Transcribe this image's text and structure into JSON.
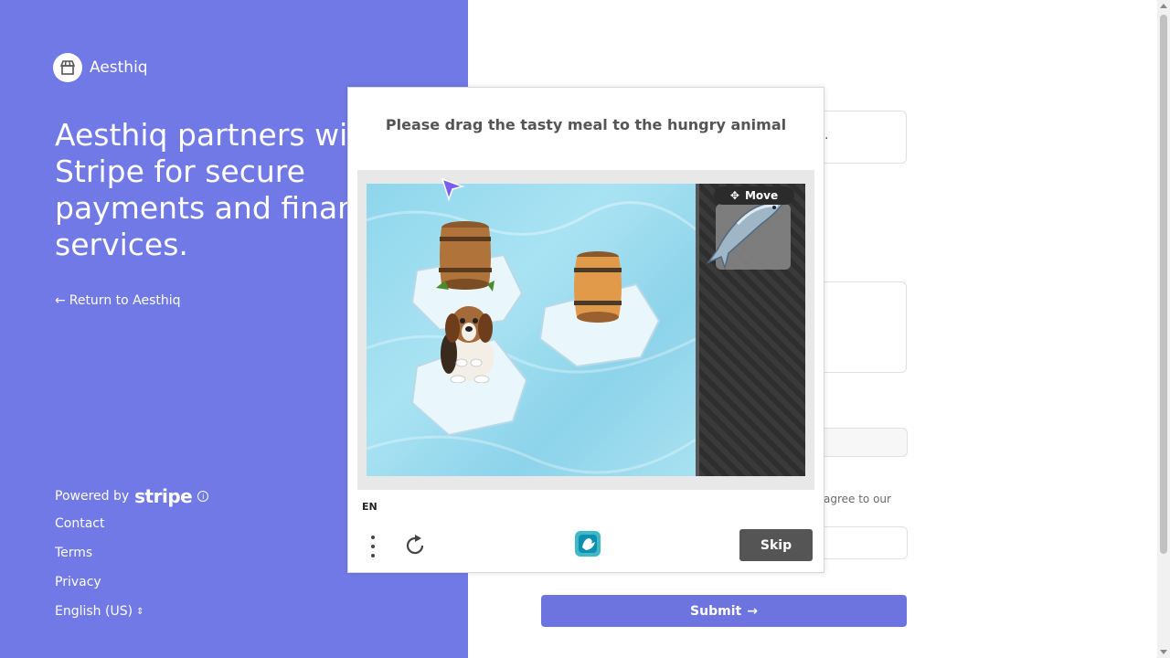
{
  "brand": {
    "name": "Aesthiq"
  },
  "left": {
    "headline": "Aesthiq partners with\nStripe for secure\npayments and financial\nservices.",
    "return_link": "Return to Aesthiq",
    "powered_by": "Powered by",
    "stripe": "stripe",
    "links": {
      "contact": "Contact",
      "terms": "Terms",
      "privacy": "Privacy"
    },
    "language": "English (US)"
  },
  "form": {
    "agree_fragment": "agree to our",
    "field_fragment": ".",
    "submit_label": "Submit"
  },
  "captcha": {
    "prompt": "Please drag the tasty meal to the hungry animal",
    "move_label": "Move",
    "language_code": "EN",
    "skip_label": "Skip"
  },
  "colors": {
    "left_panel": "#7079e6",
    "submit": "#6d74df",
    "skip": "#555555"
  }
}
